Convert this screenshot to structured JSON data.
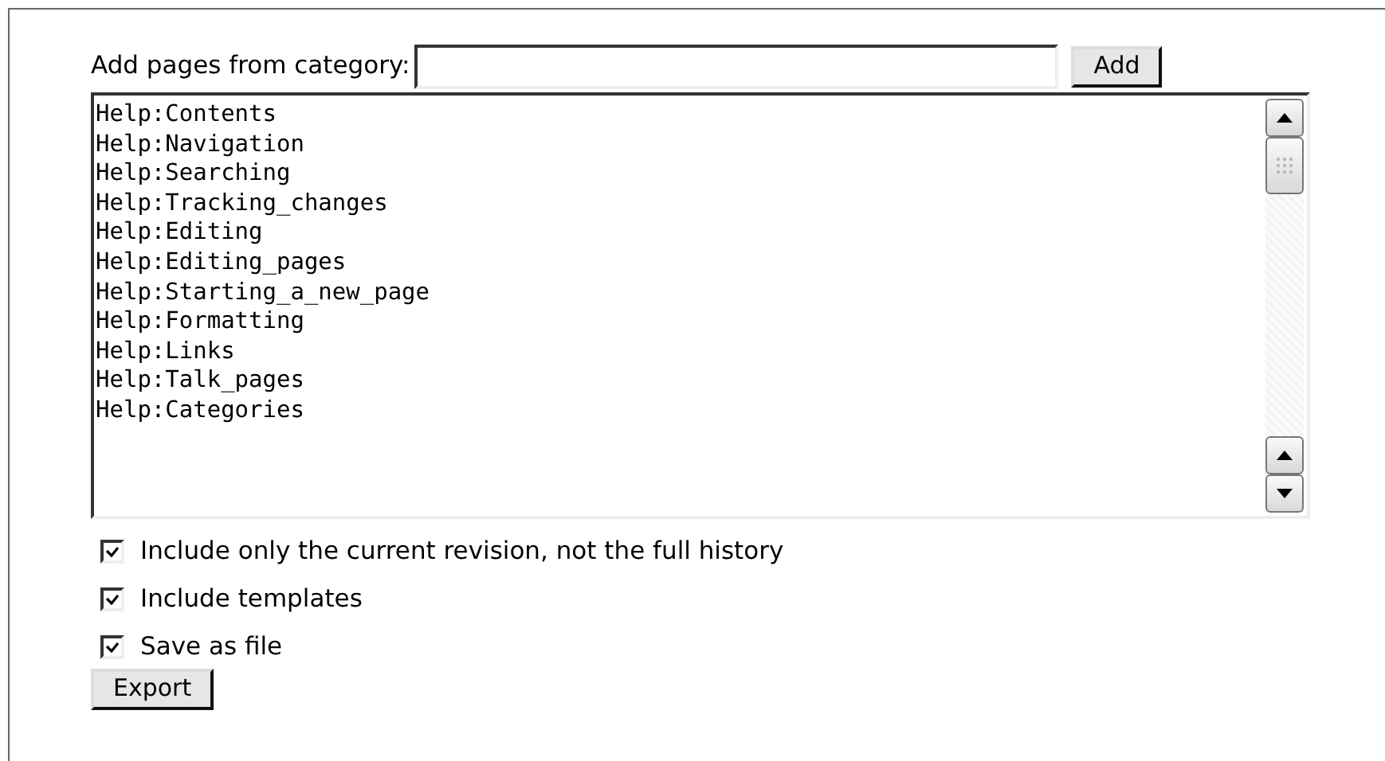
{
  "category_label": "Add pages from category:",
  "add_button": "Add",
  "pages": [
    "Help:Contents",
    "Help:Navigation",
    "Help:Searching",
    "Help:Tracking_changes",
    "Help:Editing",
    "Help:Editing_pages",
    "Help:Starting_a_new_page",
    "Help:Formatting",
    "Help:Links",
    "Help:Talk_pages",
    "Help:Categories"
  ],
  "options": [
    {
      "label": "Include only the current revision, not the full history",
      "checked": true
    },
    {
      "label": "Include templates",
      "checked": true
    },
    {
      "label": "Save as file",
      "checked": true
    }
  ],
  "export_button": "Export"
}
